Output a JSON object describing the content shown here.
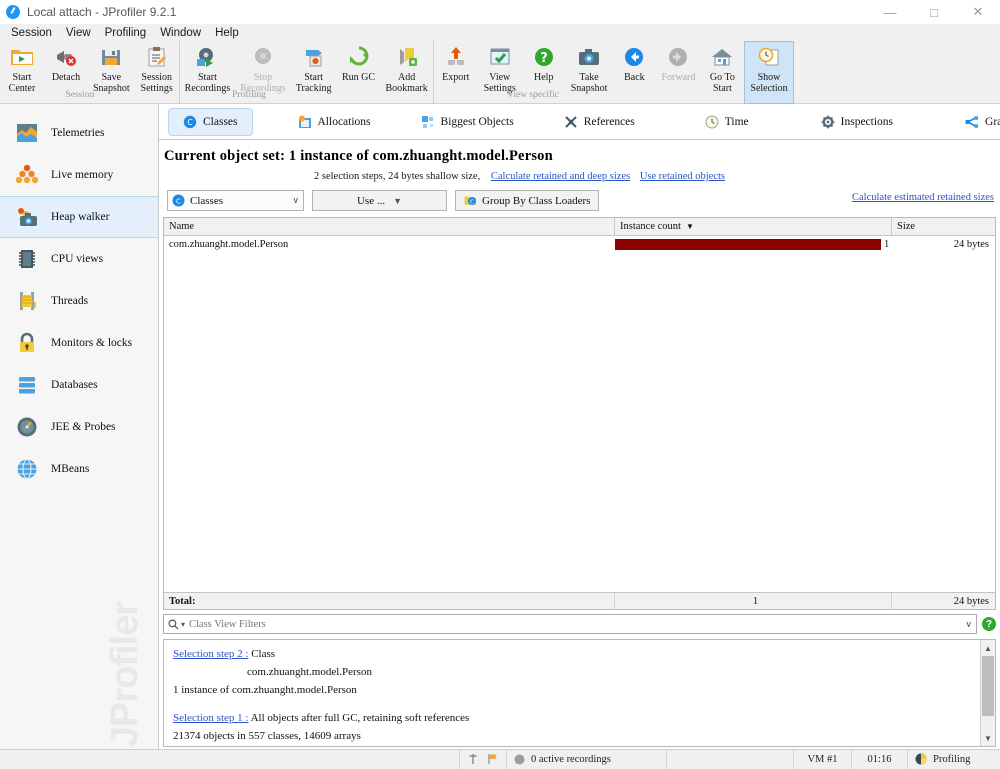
{
  "window": {
    "title": "Local attach - JProfiler 9.2.1",
    "app_icon": "jprofiler-icon",
    "controls": {
      "minimize": "—",
      "maximize": "□",
      "close": "✕"
    }
  },
  "menubar": {
    "items": [
      "Session",
      "View",
      "Profiling",
      "Window",
      "Help"
    ]
  },
  "toolbar": {
    "groups": [
      {
        "label": "Session",
        "buttons": [
          {
            "line1": "Start",
            "line2": "Center",
            "icon": "start-center-icon",
            "state": "enabled"
          },
          {
            "line1": "Detach",
            "line2": "",
            "icon": "detach-icon",
            "state": "enabled"
          },
          {
            "line1": "Save",
            "line2": "Snapshot",
            "icon": "save-snapshot-icon",
            "state": "enabled"
          },
          {
            "line1": "Session",
            "line2": "Settings",
            "icon": "session-settings-icon",
            "state": "enabled"
          }
        ]
      },
      {
        "label": "Profiling",
        "buttons": [
          {
            "line1": "Start",
            "line2": "Recordings",
            "icon": "start-recordings-icon",
            "state": "enabled"
          },
          {
            "line1": "Stop",
            "line2": "Recordings",
            "icon": "stop-recordings-icon",
            "state": "disabled"
          },
          {
            "line1": "Start",
            "line2": "Tracking",
            "icon": "start-tracking-icon",
            "state": "enabled"
          },
          {
            "line1": "Run GC",
            "line2": "",
            "icon": "run-gc-icon",
            "state": "enabled"
          },
          {
            "line1": "Add",
            "line2": "Bookmark",
            "icon": "add-bookmark-icon",
            "state": "enabled"
          }
        ]
      },
      {
        "label": "View specific",
        "buttons": [
          {
            "line1": "Export",
            "line2": "",
            "icon": "export-icon",
            "state": "enabled"
          },
          {
            "line1": "View",
            "line2": "Settings",
            "icon": "view-settings-icon",
            "state": "enabled"
          },
          {
            "line1": "Help",
            "line2": "",
            "icon": "help-icon",
            "state": "enabled"
          },
          {
            "line1": "Take",
            "line2": "Snapshot",
            "icon": "take-snapshot-icon",
            "state": "enabled"
          },
          {
            "line1": "Back",
            "line2": "",
            "icon": "back-icon",
            "state": "enabled"
          },
          {
            "line1": "Forward",
            "line2": "",
            "icon": "forward-icon",
            "state": "disabled"
          },
          {
            "line1": "Go To",
            "line2": "Start",
            "icon": "go-to-start-icon",
            "state": "enabled"
          },
          {
            "line1": "Show",
            "line2": "Selection",
            "icon": "show-selection-icon",
            "state": "selected"
          }
        ]
      }
    ]
  },
  "sidebar": {
    "items": [
      {
        "label": "Telemetries",
        "icon": "telemetries-icon",
        "active": false
      },
      {
        "label": "Live memory",
        "icon": "live-memory-icon",
        "active": false
      },
      {
        "label": "Heap walker",
        "icon": "heap-walker-icon",
        "active": true
      },
      {
        "label": "CPU views",
        "icon": "cpu-views-icon",
        "active": false
      },
      {
        "label": "Threads",
        "icon": "threads-icon",
        "active": false
      },
      {
        "label": "Monitors & locks",
        "icon": "monitors-locks-icon",
        "active": false
      },
      {
        "label": "Databases",
        "icon": "databases-icon",
        "active": false
      },
      {
        "label": "JEE & Probes",
        "icon": "jee-probes-icon",
        "active": false
      },
      {
        "label": "MBeans",
        "icon": "mbeans-icon",
        "active": false
      }
    ],
    "watermark": "JProfiler"
  },
  "tabs": [
    {
      "label": "Classes",
      "icon": "classes-icon",
      "active": true
    },
    {
      "label": "Allocations",
      "icon": "allocations-icon",
      "active": false
    },
    {
      "label": "Biggest Objects",
      "icon": "biggest-objects-icon",
      "active": false
    },
    {
      "label": "References",
      "icon": "references-icon",
      "active": false
    },
    {
      "label": "Time",
      "icon": "time-icon",
      "active": false
    },
    {
      "label": "Inspections",
      "icon": "inspections-icon",
      "active": false
    },
    {
      "label": "Graph",
      "icon": "graph-icon",
      "active": false
    }
  ],
  "header": {
    "title": "Current object set: 1 instance of com.zhuanght.model.Person",
    "subtitle": "2 selection steps, 24 bytes shallow size,",
    "link_calculate_retained_deep": "Calculate retained and deep sizes",
    "link_use_retained_objects": "Use retained objects"
  },
  "controls": {
    "aggregation_combo": {
      "value": "Classes",
      "icon": "class-blue-icon",
      "chevron": "∨"
    },
    "use_combo": {
      "value": "Use ...",
      "chevron": "▼"
    },
    "group_button": {
      "label": "Group By Class Loaders",
      "icon": "class-loader-icon"
    },
    "link_calculate_estimated": "Calculate estimated retained sizes"
  },
  "table": {
    "columns": [
      {
        "label": "Name",
        "sorted": false
      },
      {
        "label": "Instance count",
        "sorted": true,
        "sort_arrow": "▼"
      },
      {
        "label": "Size",
        "sorted": false
      }
    ],
    "rows": [
      {
        "name": "com.zhuanght.model.Person",
        "instance_count": "1",
        "bar_percent": 100,
        "bar_color": "#8b0000",
        "size": "24 bytes"
      }
    ],
    "total": {
      "label": "Total:",
      "instance_count": "1",
      "size": "24 bytes"
    }
  },
  "filter": {
    "placeholder": "Class View Filters",
    "search_icon": "search-icon",
    "chevron": "∨",
    "help_icon": "help-circle-icon",
    "help_char": "?"
  },
  "selection_steps": {
    "lines": [
      {
        "link": "Selection step 2 :",
        "text": " Class",
        "indent": false
      },
      {
        "link": "",
        "text": "com.zhuanght.model.Person",
        "indent": true
      },
      {
        "link": "",
        "text": "1 instance of com.zhuanght.model.Person",
        "indent": false
      },
      {
        "link": "",
        "text": "",
        "indent": false
      },
      {
        "link": "Selection step 1 :",
        "text": " All objects after full GC, retaining soft references",
        "indent": false
      },
      {
        "link": "",
        "text": "21374 objects in 557 classes, 14609 arrays",
        "indent": false
      }
    ]
  },
  "statusbar": {
    "cells": [
      {
        "kind": "icons",
        "icons": [
          "thread-icon",
          "bookmark-flag-icon"
        ]
      },
      {
        "kind": "recordings",
        "icon": "record-dot-icon",
        "text": "0 active recordings"
      },
      {
        "kind": "spacer",
        "text": ""
      },
      {
        "kind": "text",
        "text": "VM #1"
      },
      {
        "kind": "text",
        "text": "01:16"
      },
      {
        "kind": "profiling",
        "icon": "profiling-pie-icon",
        "text": "Profiling"
      }
    ]
  },
  "colors": {
    "accent_blue": "#2196f3",
    "selection_blue": "#e3f0fb",
    "bar_red": "#8b0000",
    "link_blue": "#2a54c8"
  }
}
